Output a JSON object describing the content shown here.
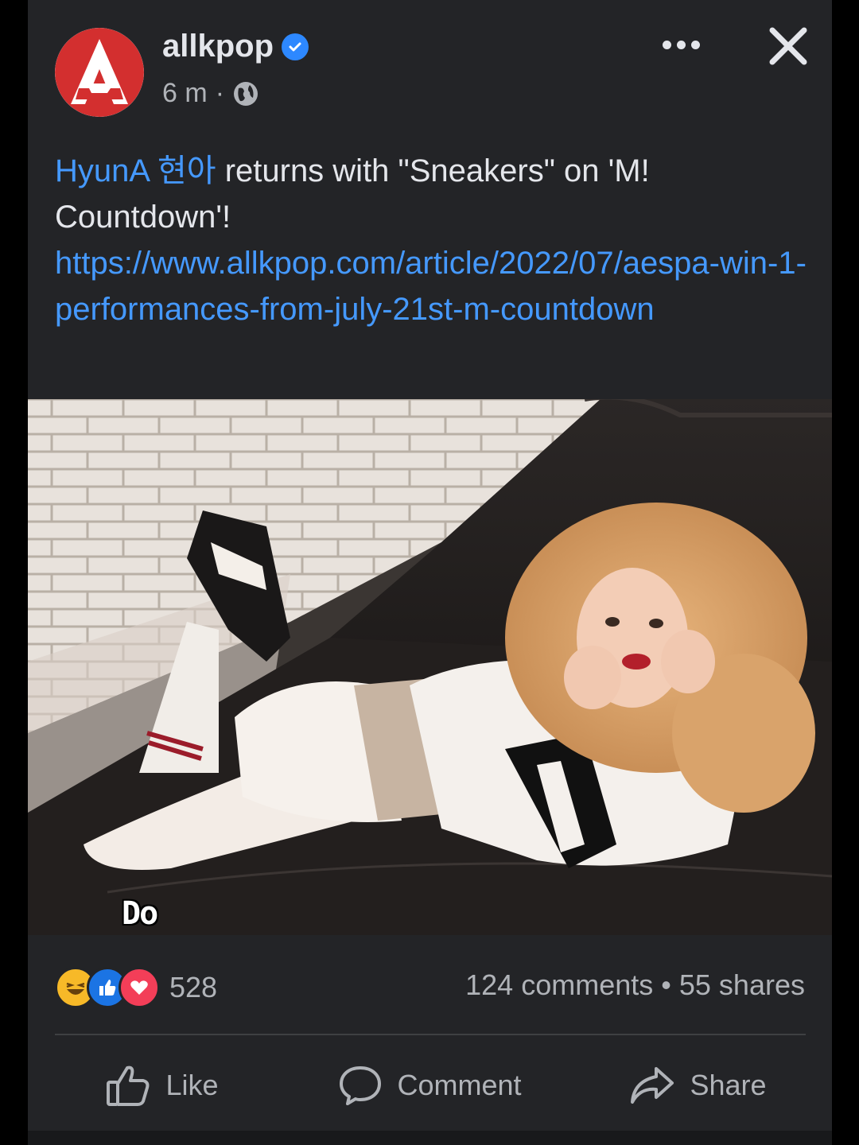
{
  "post": {
    "page_name": "allkpop",
    "time": "6 m",
    "separator": "·",
    "mention": "HyunA 현아",
    "text": " returns with \"Sneakers\" on 'M! Countdown'!",
    "link": "https://www.allkpop.com/article/2022/07/aespa-win-1-performances-from-july-21st-m-countdown",
    "image_overlay_text": "Do"
  },
  "engagement": {
    "reaction_count": "528",
    "comments": "124 comments",
    "dot": "•",
    "shares": "55 shares"
  },
  "actions": {
    "like": "Like",
    "comment": "Comment",
    "share": "Share"
  },
  "icons": [
    "allkpop-logo",
    "verified-badge-icon",
    "globe-icon",
    "more-options-icon",
    "close-icon",
    "haha-reaction-icon",
    "like-reaction-icon",
    "love-reaction-icon",
    "thumbs-up-icon",
    "comment-bubble-icon",
    "share-arrow-icon"
  ],
  "colors": {
    "background": "#232427",
    "link": "#4599ff",
    "verified": "#2d88ff",
    "logo_red": "#d32f2f"
  }
}
